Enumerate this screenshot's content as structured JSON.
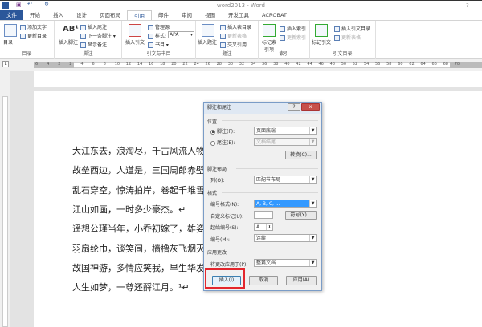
{
  "window": {
    "title": "word2013 - Word",
    "help": "?"
  },
  "tabs": [
    "文件",
    "开始",
    "插入",
    "设计",
    "页面布局",
    "引用",
    "邮件",
    "审阅",
    "视图",
    "开发工具",
    "ACROBAT"
  ],
  "ribbon": {
    "toc": {
      "big": "目录",
      "add_text": "添加文字",
      "update": "更新目录",
      "label": "目录"
    },
    "footnote": {
      "big": "插入脚注",
      "insert_endnote": "插入尾注",
      "next": "下一条脚注",
      "show": "显示备注",
      "label": "脚注"
    },
    "citation": {
      "big": "插入引文",
      "manage": "管理源",
      "style_label": "样式:",
      "style_value": "APA",
      "bib": "书目",
      "label": "引文与书目"
    },
    "caption": {
      "big": "插入题注",
      "insert_table": "插入表目录",
      "update_table": "更新表格",
      "cross": "交叉引用",
      "label": "题注"
    },
    "index": {
      "big": "标记索引项",
      "insert": "插入索引",
      "update": "更新索引",
      "label": "索引"
    },
    "toa": {
      "big": "标记引文",
      "insert": "插入引文目录",
      "update": "更新表格",
      "label": "引文目录"
    }
  },
  "ruler": [
    "6",
    "4",
    "2",
    "2",
    "4",
    "6",
    "8",
    "10",
    "12",
    "14",
    "16",
    "18",
    "20",
    "22",
    "24",
    "26",
    "28",
    "30",
    "32",
    "34",
    "36",
    "38",
    "40",
    "42",
    "44",
    "46",
    "48",
    "50",
    "52",
    "54",
    "56",
    "58",
    "60",
    "62",
    "64",
    "66",
    "68",
    "70"
  ],
  "document": {
    "lines": [
      "大江东去，浪淘尽，千古风流人物。",
      "故垒西边，人道是，三国周郎赤壁。",
      "乱石穿空，惊涛拍岸，卷起千堆雪。",
      "江山如画，一时多少豪杰。↵",
      "遥想公瑾当年，小乔初嫁了，雄姿英发。",
      "羽扇纶巾，谈笑间，樯橹灰飞烟灭。",
      "故国神游，多情应笑我，早生华发。",
      "人生如梦，一尊还酹江月。¹↵"
    ]
  },
  "dialog": {
    "title": "脚注和尾注",
    "help": "?",
    "close": "x",
    "position": "位置",
    "footnote": "脚注(F):",
    "footnote_value": "页面底端",
    "endnote": "尾注(E):",
    "endnote_value": "文档结尾",
    "convert": "转换(C)...",
    "layout": "脚注布局",
    "columns": "列(O):",
    "columns_value": "匹配节布局",
    "format": "格式",
    "number_format": "编号格式(N):",
    "number_format_value": "A, B, C, ...",
    "custom_mark": "自定义标记(U):",
    "symbol": "符号(Y)...",
    "start_at": "起始编号(S):",
    "start_value": "A",
    "numbering": "编号(M):",
    "numbering_value": "连续",
    "apply": "应用更改",
    "apply_to": "将更改应用于(P):",
    "apply_to_value": "整篇文档",
    "insert": "插入(I)",
    "cancel": "取消",
    "apply_btn": "应用(A)"
  },
  "colors": {
    "accent": "#2b579a",
    "highlight": "#e3262d",
    "selection": "#3399ff"
  }
}
